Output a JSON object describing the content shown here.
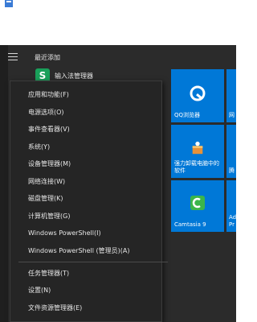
{
  "recent": {
    "header": "最近添加",
    "app_label": "输入法管理器",
    "app_icon": "sogou-s-icon"
  },
  "context_menu": {
    "items": [
      "应用和功能(F)",
      "电源选项(O)",
      "事件查看器(V)",
      "系统(Y)",
      "设备管理器(M)",
      "网络连接(W)",
      "磁盘管理(K)",
      "计算机管理(G)",
      "Windows PowerShell(I)",
      "Windows PowerShell (管理员)(A)",
      "任务管理器(T)",
      "设置(N)",
      "文件资源管理器(E)"
    ]
  },
  "tiles": {
    "qq_browser": "QQ浏览器",
    "partial_1": "网",
    "uninstaller": "强力卸载电脑中的软件",
    "partial_2": "腾",
    "camtasia": "Camtasia 9",
    "partial_3": "Ad Pr"
  },
  "colors": {
    "tile_blue": "#0078d7",
    "menu_bg": "#2b2b2b",
    "context_bg": "#252525",
    "text": "#e6e6e6",
    "accent_green": "#19a05a"
  }
}
